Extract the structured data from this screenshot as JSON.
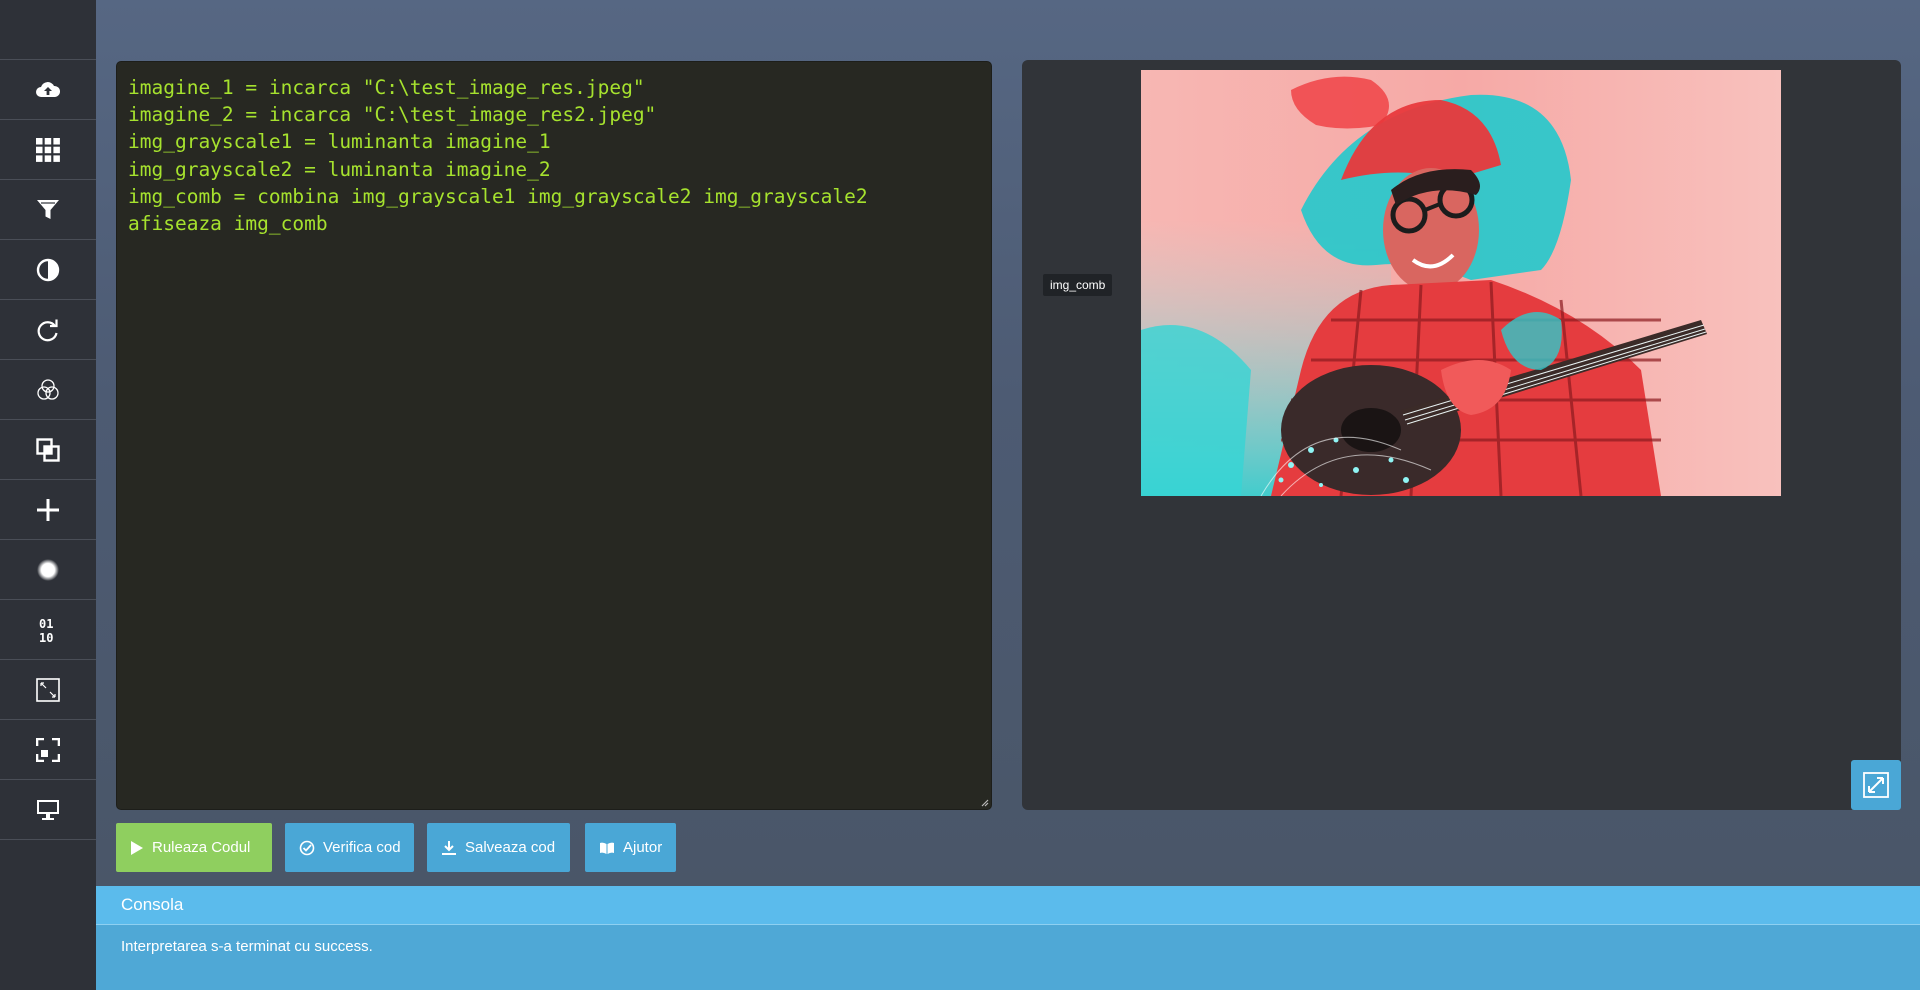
{
  "sidebar": {
    "items": [
      {
        "icon": "cloud-upload-icon"
      },
      {
        "icon": "grid-icon"
      },
      {
        "icon": "filter-icon"
      },
      {
        "icon": "contrast-icon"
      },
      {
        "icon": "rotate-icon"
      },
      {
        "icon": "color-channels-icon"
      },
      {
        "icon": "overlay-icon"
      },
      {
        "icon": "plus-icon"
      },
      {
        "icon": "blur-dot-icon"
      },
      {
        "icon": "binary-icon"
      },
      {
        "icon": "resize-image-icon"
      },
      {
        "icon": "crop-expand-icon"
      },
      {
        "icon": "monitor-icon"
      }
    ]
  },
  "editor": {
    "code": "imagine_1 = incarca \"C:\\test_image_res.jpeg\"\nimagine_2 = incarca \"C:\\test_image_res2.jpeg\"\nimg_grayscale1 = luminanta imagine_1\nimg_grayscale2 = luminanta imagine_2\nimg_comb = combina img_grayscale1 img_grayscale2 img_grayscale2\nafiseaza img_comb",
    "text_color": "#a6e22e",
    "background": "#272822"
  },
  "viewer": {
    "image_label": "img_comb",
    "expand_icon": "expand-icon"
  },
  "buttons": {
    "run": "Ruleaza Codul",
    "verify": "Verifica cod",
    "save": "Salveaza cod",
    "help": "Ajutor"
  },
  "console": {
    "title": "Consola",
    "message": "Interpretarea s-a terminat cu success."
  },
  "colors": {
    "accent_blue": "#4aa7d6",
    "run_green": "#8fcf5f",
    "sidebar": "#2e3138"
  }
}
